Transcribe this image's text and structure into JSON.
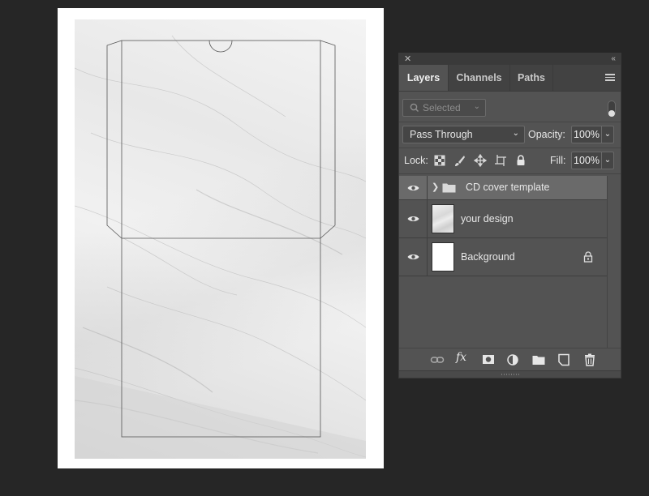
{
  "panel": {
    "close_glyph": "✕",
    "collapse_glyph": "‹‹",
    "tabs": [
      {
        "label": "Layers",
        "active": true
      },
      {
        "label": "Channels",
        "active": false
      },
      {
        "label": "Paths",
        "active": false
      }
    ],
    "menu_icon": "hamburger-menu-icon",
    "filter": {
      "placeholder": "Selected",
      "icon": "search-icon"
    },
    "blend_mode": "Pass Through",
    "opacity_label": "Opacity:",
    "opacity_value": "100%",
    "lock_label": "Lock:",
    "fill_label": "Fill:",
    "fill_value": "100%",
    "layers": [
      {
        "name": "CD cover template",
        "type": "group",
        "visible": true,
        "selected": true
      },
      {
        "name": "your design",
        "type": "image",
        "visible": true,
        "selected": false
      },
      {
        "name": "Background",
        "type": "background",
        "visible": true,
        "locked": true,
        "selected": false
      }
    ],
    "bottom_icons": [
      "link-icon",
      "fx-icon",
      "mask-icon",
      "adjustment-icon",
      "folder-icon",
      "new-layer-icon",
      "trash-icon"
    ],
    "fx_label": "fx"
  },
  "colors": {
    "app_bg": "#262626",
    "panel_bg": "#535353",
    "selected_row": "#6a6a6a"
  }
}
